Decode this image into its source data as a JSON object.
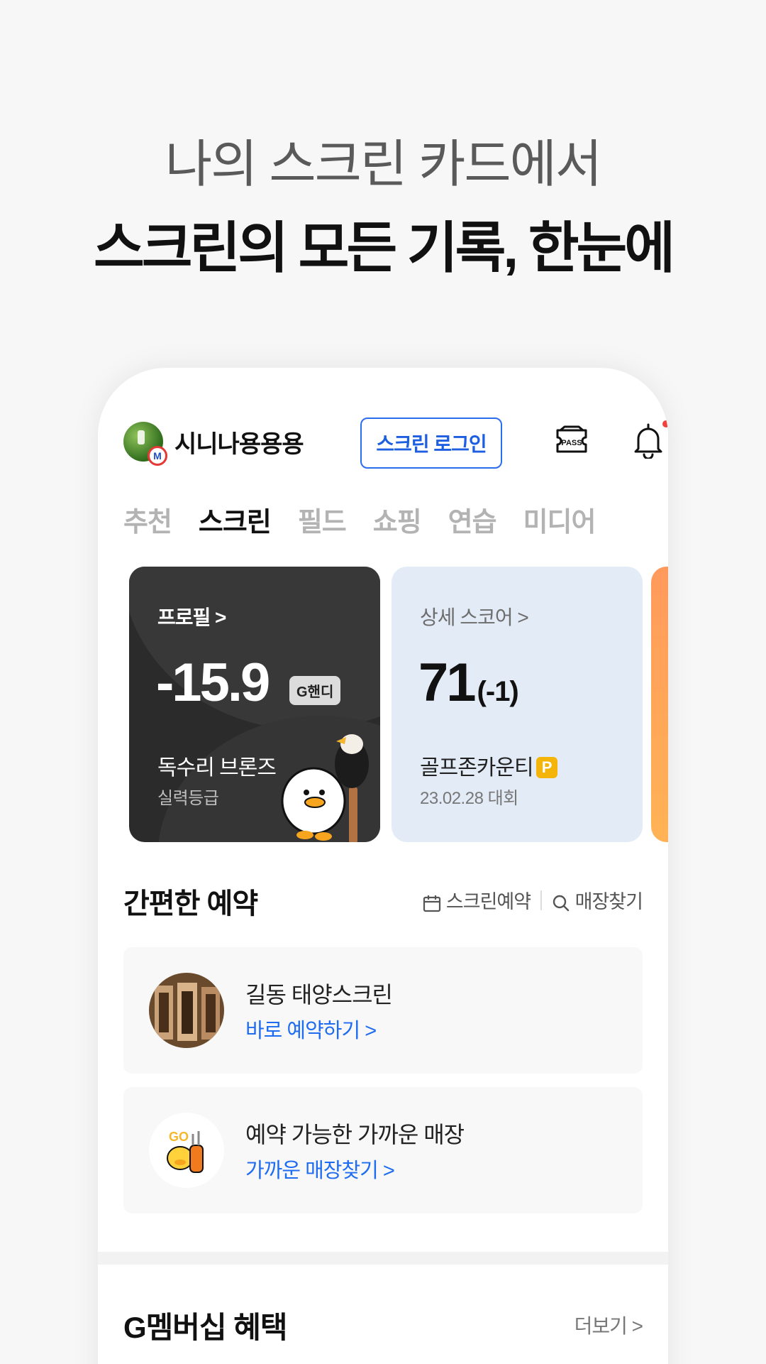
{
  "headline": {
    "subtitle": "나의 스크린 카드에서",
    "title": "스크린의 모든 기록, 한눈에"
  },
  "header": {
    "username": "시니나용용용",
    "avatar_badge": "M",
    "login_button": "스크린 로그인",
    "pass_icon_label": "PASS"
  },
  "tabs": [
    "추천",
    "스크린",
    "필드",
    "쇼핑",
    "연습",
    "미디어"
  ],
  "active_tab": "스크린",
  "cards": {
    "profile": {
      "link": "프로필 >",
      "value": "-15.9",
      "tag": "G핸디",
      "grade": "독수리 브론즈",
      "grade_label": "실력등급"
    },
    "score": {
      "link": "상세 스코어 >",
      "value": "71",
      "diff": "(-1)",
      "venue": "골프존카운티",
      "venue_badge": "P",
      "date": "23.02.28  대회"
    }
  },
  "reservation": {
    "title": "간편한 예약",
    "screen_reserve": "스크린예약",
    "find_store": "매장찾기",
    "items": [
      {
        "title": "길동 태양스크린",
        "action": "바로 예약하기  >"
      },
      {
        "title": "예약 가능한 가까운 매장",
        "action": "가까운 매장찾기  >"
      }
    ]
  },
  "membership": {
    "title": "G멤버십 혜택",
    "more": "더보기  >"
  },
  "colors": {
    "accent_blue": "#1f6cf0",
    "dark_card": "#2b2b2b",
    "light_card": "#e2ebf6",
    "notification_dot": "#f0413c",
    "badge_gold": "#f5b40a"
  }
}
